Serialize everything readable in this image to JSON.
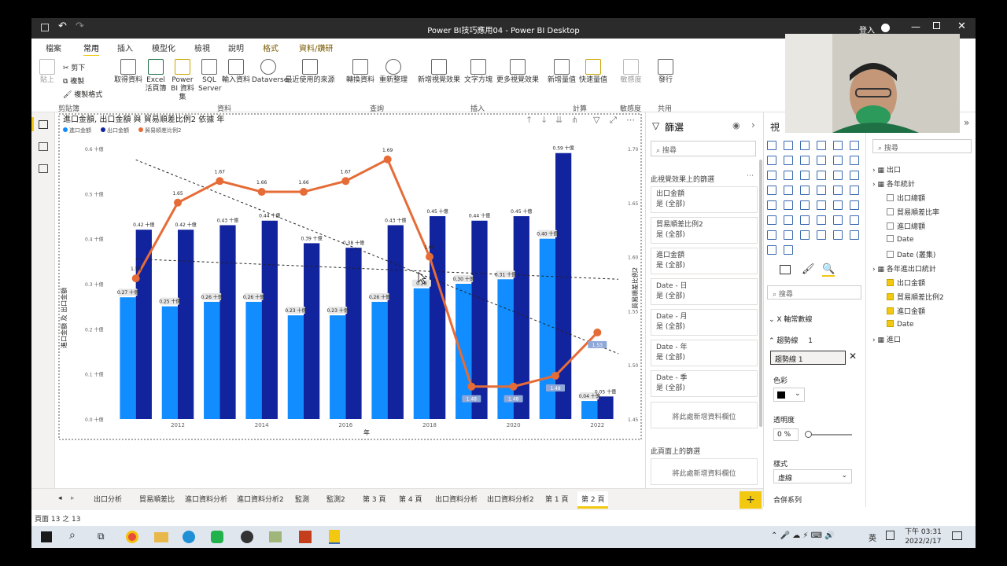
{
  "titlebar": {
    "title": "Power BI技巧應用04 - Power BI Desktop",
    "signin": "登入"
  },
  "menu_tabs": [
    "檔案",
    "常用",
    "插入",
    "模型化",
    "檢視",
    "說明",
    "格式",
    "資料/鑽研"
  ],
  "ribbon": {
    "clipboard": {
      "paste": "貼上",
      "cut": "剪下",
      "copy": "複製",
      "format": "複製格式",
      "group": "剪貼簿"
    },
    "data": {
      "items": [
        "取得資料",
        "Excel 活頁簿",
        "Power BI 資料集",
        "SQL Server",
        "輸入資料",
        "Dataverse",
        "最近使用的來源"
      ],
      "group": "資料"
    },
    "query": {
      "items": [
        "轉換資料",
        "重新整理"
      ],
      "group": "查詢"
    },
    "insert": {
      "items": [
        "新增視覺效果",
        "文字方塊",
        "更多視覺效果"
      ],
      "group": "插入"
    },
    "calc": {
      "items": [
        "新增量值",
        "快速量值"
      ],
      "group": "計算"
    },
    "sensitivity": {
      "items": [
        "敏感度"
      ],
      "group": "敏感度"
    },
    "share": {
      "items": [
        "發行"
      ],
      "group": "共用"
    }
  },
  "chart_data": {
    "type": "bar+line",
    "title": "進口金額, 出口金額 與 貿易順差比例2 依據 年",
    "legend": [
      "進口金額",
      "出口金額",
      "貿易順差比例2"
    ],
    "colors": {
      "import": "#118dff",
      "export": "#12239e",
      "ratio": "#e66c37"
    },
    "xlabel": "年",
    "ylabel": "進口金額 及 出口金額",
    "y2label": "貿易順差比例2",
    "categories": [
      "2011",
      "2012",
      "2013",
      "2014",
      "2015",
      "2016",
      "2017",
      "2018",
      "2019",
      "2020",
      "2021",
      "2022"
    ],
    "x_ticks": [
      "2012",
      "2014",
      "2016",
      "2018",
      "2020",
      "2022"
    ],
    "series": [
      {
        "name": "進口金額",
        "values": [
          0.27,
          0.25,
          0.26,
          0.26,
          0.23,
          0.23,
          0.26,
          0.29,
          0.3,
          0.31,
          0.4,
          0.04
        ],
        "labels": [
          "0.27 十億",
          "0.25 十億",
          "0.26 十億",
          "0.26 十億",
          "0.23 十億",
          "0.23 十億",
          "0.26 十億",
          "0.28",
          "0.30 十億",
          "0.31 十億",
          "0.40 十億",
          "0.04 十億"
        ]
      },
      {
        "name": "出口金額",
        "values": [
          0.42,
          0.42,
          0.43,
          0.44,
          0.39,
          0.38,
          0.43,
          0.45,
          0.44,
          0.45,
          0.59,
          0.05
        ],
        "labels": [
          "0.42 十億",
          "0.42 十億",
          "0.43 十億",
          "0.44 十億",
          "0.39 十億",
          "0.38 十億",
          "0.43 十億",
          "0.45 十億",
          "0.44 十億",
          "0.45 十億",
          "0.59 十億",
          "0.05 十億"
        ]
      },
      {
        "name": "貿易順差比例2",
        "values": [
          1.58,
          1.65,
          1.67,
          1.66,
          1.66,
          1.67,
          1.69,
          1.6,
          1.48,
          1.48,
          1.49,
          1.53
        ],
        "labels": [
          "1.58",
          "1.65",
          "1.67",
          "1.66",
          "1.66",
          "1.67",
          "1.69",
          "1.60",
          "1.48",
          "1.48",
          "1.48",
          "1.53"
        ]
      }
    ],
    "y_ticks": [
      "0.0 十億",
      "0.1 十億",
      "0.2 十億",
      "0.3 十億",
      "0.4 十億",
      "0.5 十億",
      "0.6 十億"
    ],
    "ylim": [
      0,
      0.6
    ],
    "y2_ticks": [
      "1.45",
      "1.50",
      "1.55",
      "1.60",
      "1.65",
      "1.70"
    ],
    "y2lim": [
      1.45,
      1.7
    ],
    "trendlines": [
      {
        "from": [
          2011,
          0.575
        ],
        "to": [
          2022,
          0.145
        ]
      },
      {
        "from": [
          2011,
          0.355
        ],
        "to": [
          2022,
          0.31
        ]
      }
    ]
  },
  "filters": {
    "title": "篩選",
    "search": "搜尋",
    "on_visual": "此視覺效果上的篩選",
    "cards": [
      {
        "name": "出口金額",
        "value": "是 (全部)"
      },
      {
        "name": "貿易順差比例2",
        "value": "是 (全部)"
      },
      {
        "name": "進口金額",
        "value": "是 (全部)"
      },
      {
        "name": "Date - 日",
        "value": "是 (全部)"
      },
      {
        "name": "Date - 月",
        "value": "是 (全部)"
      },
      {
        "name": "Date - 年",
        "value": "是 (全部)"
      },
      {
        "name": "Date - 季",
        "value": "是 (全部)"
      }
    ],
    "add_here": "將此處新增資料欄位",
    "on_page": "此頁面上的篩選",
    "add_here2": "將此處新增資料欄位"
  },
  "viz": {
    "title": "視",
    "search": "搜尋",
    "xaxis": "X 軸常數線",
    "trend": "趨勢線",
    "trend_count": "1",
    "trend_name": "趨勢線 1",
    "color": "色彩",
    "transparency": "透明度",
    "transparency_val": "0",
    "pct": "%",
    "style": "樣式",
    "style_val": "虛線",
    "combine": "合併系列"
  },
  "fields": {
    "search": "搜尋",
    "items": [
      {
        "label": "出口",
        "level": 0,
        "type": "table"
      },
      {
        "label": "各年統計",
        "level": 0,
        "type": "table"
      },
      {
        "label": "出口總額",
        "level": 1,
        "check": false
      },
      {
        "label": "貿易順差比率",
        "level": 1,
        "check": false
      },
      {
        "label": "進口總額",
        "level": 1,
        "check": false
      },
      {
        "label": "Date",
        "level": 1,
        "check": false
      },
      {
        "label": "Date (叢集)",
        "level": 1,
        "check": false
      },
      {
        "label": "各年進出口統計",
        "level": 0,
        "type": "table"
      },
      {
        "label": "出口金額",
        "level": 1,
        "check": true
      },
      {
        "label": "貿易順差比例2",
        "level": 1,
        "check": true
      },
      {
        "label": "進口金額",
        "level": 1,
        "check": true
      },
      {
        "label": "Date",
        "level": 1,
        "check": true
      },
      {
        "label": "進口",
        "level": 0,
        "type": "table"
      }
    ]
  },
  "page_tabs": [
    "出口分析",
    "貿易順差比",
    "進口資料分析",
    "進口資料分析2",
    "監測",
    "監測2",
    "第 3 頁",
    "第 4 頁",
    "出口資料分析",
    "出口資料分析2",
    "第 1 頁",
    "第 2 頁"
  ],
  "active_tab": "第 2 頁",
  "status": "頁面 13 之 13",
  "taskbar": {
    "ime": "英",
    "time": "下午 03:31",
    "date": "2022/2/17"
  }
}
